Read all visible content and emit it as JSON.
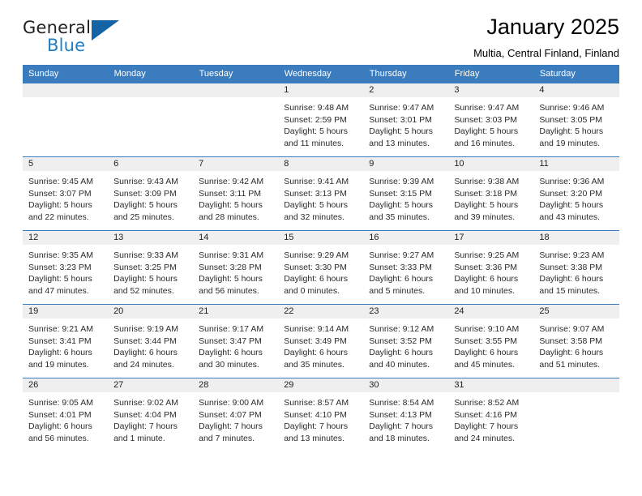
{
  "brand": {
    "name_part1": "General",
    "name_part2": "Blue",
    "triangle_color": "#1464a5",
    "blue_color": "#1f7fc4"
  },
  "header": {
    "title": "January 2025",
    "subtitle": "Multia, Central Finland, Finland"
  },
  "theme": {
    "header_bar_color": "#3a7cbe",
    "daynum_band_color": "#efefef",
    "cell_background": "#ffffff",
    "text_color": "#2b2b2b"
  },
  "weekdays": [
    "Sunday",
    "Monday",
    "Tuesday",
    "Wednesday",
    "Thursday",
    "Friday",
    "Saturday"
  ],
  "weeks": [
    [
      {
        "day": "",
        "empty": true,
        "sunrise": "",
        "sunset": "",
        "daylight_line1": "",
        "daylight_line2": ""
      },
      {
        "day": "",
        "empty": true,
        "sunrise": "",
        "sunset": "",
        "daylight_line1": "",
        "daylight_line2": ""
      },
      {
        "day": "",
        "empty": true,
        "sunrise": "",
        "sunset": "",
        "daylight_line1": "",
        "daylight_line2": ""
      },
      {
        "day": "1",
        "empty": false,
        "sunrise": "Sunrise: 9:48 AM",
        "sunset": "Sunset: 2:59 PM",
        "daylight_line1": "Daylight: 5 hours",
        "daylight_line2": "and 11 minutes."
      },
      {
        "day": "2",
        "empty": false,
        "sunrise": "Sunrise: 9:47 AM",
        "sunset": "Sunset: 3:01 PM",
        "daylight_line1": "Daylight: 5 hours",
        "daylight_line2": "and 13 minutes."
      },
      {
        "day": "3",
        "empty": false,
        "sunrise": "Sunrise: 9:47 AM",
        "sunset": "Sunset: 3:03 PM",
        "daylight_line1": "Daylight: 5 hours",
        "daylight_line2": "and 16 minutes."
      },
      {
        "day": "4",
        "empty": false,
        "sunrise": "Sunrise: 9:46 AM",
        "sunset": "Sunset: 3:05 PM",
        "daylight_line1": "Daylight: 5 hours",
        "daylight_line2": "and 19 minutes."
      }
    ],
    [
      {
        "day": "5",
        "empty": false,
        "sunrise": "Sunrise: 9:45 AM",
        "sunset": "Sunset: 3:07 PM",
        "daylight_line1": "Daylight: 5 hours",
        "daylight_line2": "and 22 minutes."
      },
      {
        "day": "6",
        "empty": false,
        "sunrise": "Sunrise: 9:43 AM",
        "sunset": "Sunset: 3:09 PM",
        "daylight_line1": "Daylight: 5 hours",
        "daylight_line2": "and 25 minutes."
      },
      {
        "day": "7",
        "empty": false,
        "sunrise": "Sunrise: 9:42 AM",
        "sunset": "Sunset: 3:11 PM",
        "daylight_line1": "Daylight: 5 hours",
        "daylight_line2": "and 28 minutes."
      },
      {
        "day": "8",
        "empty": false,
        "sunrise": "Sunrise: 9:41 AM",
        "sunset": "Sunset: 3:13 PM",
        "daylight_line1": "Daylight: 5 hours",
        "daylight_line2": "and 32 minutes."
      },
      {
        "day": "9",
        "empty": false,
        "sunrise": "Sunrise: 9:39 AM",
        "sunset": "Sunset: 3:15 PM",
        "daylight_line1": "Daylight: 5 hours",
        "daylight_line2": "and 35 minutes."
      },
      {
        "day": "10",
        "empty": false,
        "sunrise": "Sunrise: 9:38 AM",
        "sunset": "Sunset: 3:18 PM",
        "daylight_line1": "Daylight: 5 hours",
        "daylight_line2": "and 39 minutes."
      },
      {
        "day": "11",
        "empty": false,
        "sunrise": "Sunrise: 9:36 AM",
        "sunset": "Sunset: 3:20 PM",
        "daylight_line1": "Daylight: 5 hours",
        "daylight_line2": "and 43 minutes."
      }
    ],
    [
      {
        "day": "12",
        "empty": false,
        "sunrise": "Sunrise: 9:35 AM",
        "sunset": "Sunset: 3:23 PM",
        "daylight_line1": "Daylight: 5 hours",
        "daylight_line2": "and 47 minutes."
      },
      {
        "day": "13",
        "empty": false,
        "sunrise": "Sunrise: 9:33 AM",
        "sunset": "Sunset: 3:25 PM",
        "daylight_line1": "Daylight: 5 hours",
        "daylight_line2": "and 52 minutes."
      },
      {
        "day": "14",
        "empty": false,
        "sunrise": "Sunrise: 9:31 AM",
        "sunset": "Sunset: 3:28 PM",
        "daylight_line1": "Daylight: 5 hours",
        "daylight_line2": "and 56 minutes."
      },
      {
        "day": "15",
        "empty": false,
        "sunrise": "Sunrise: 9:29 AM",
        "sunset": "Sunset: 3:30 PM",
        "daylight_line1": "Daylight: 6 hours",
        "daylight_line2": "and 0 minutes."
      },
      {
        "day": "16",
        "empty": false,
        "sunrise": "Sunrise: 9:27 AM",
        "sunset": "Sunset: 3:33 PM",
        "daylight_line1": "Daylight: 6 hours",
        "daylight_line2": "and 5 minutes."
      },
      {
        "day": "17",
        "empty": false,
        "sunrise": "Sunrise: 9:25 AM",
        "sunset": "Sunset: 3:36 PM",
        "daylight_line1": "Daylight: 6 hours",
        "daylight_line2": "and 10 minutes."
      },
      {
        "day": "18",
        "empty": false,
        "sunrise": "Sunrise: 9:23 AM",
        "sunset": "Sunset: 3:38 PM",
        "daylight_line1": "Daylight: 6 hours",
        "daylight_line2": "and 15 minutes."
      }
    ],
    [
      {
        "day": "19",
        "empty": false,
        "sunrise": "Sunrise: 9:21 AM",
        "sunset": "Sunset: 3:41 PM",
        "daylight_line1": "Daylight: 6 hours",
        "daylight_line2": "and 19 minutes."
      },
      {
        "day": "20",
        "empty": false,
        "sunrise": "Sunrise: 9:19 AM",
        "sunset": "Sunset: 3:44 PM",
        "daylight_line1": "Daylight: 6 hours",
        "daylight_line2": "and 24 minutes."
      },
      {
        "day": "21",
        "empty": false,
        "sunrise": "Sunrise: 9:17 AM",
        "sunset": "Sunset: 3:47 PM",
        "daylight_line1": "Daylight: 6 hours",
        "daylight_line2": "and 30 minutes."
      },
      {
        "day": "22",
        "empty": false,
        "sunrise": "Sunrise: 9:14 AM",
        "sunset": "Sunset: 3:49 PM",
        "daylight_line1": "Daylight: 6 hours",
        "daylight_line2": "and 35 minutes."
      },
      {
        "day": "23",
        "empty": false,
        "sunrise": "Sunrise: 9:12 AM",
        "sunset": "Sunset: 3:52 PM",
        "daylight_line1": "Daylight: 6 hours",
        "daylight_line2": "and 40 minutes."
      },
      {
        "day": "24",
        "empty": false,
        "sunrise": "Sunrise: 9:10 AM",
        "sunset": "Sunset: 3:55 PM",
        "daylight_line1": "Daylight: 6 hours",
        "daylight_line2": "and 45 minutes."
      },
      {
        "day": "25",
        "empty": false,
        "sunrise": "Sunrise: 9:07 AM",
        "sunset": "Sunset: 3:58 PM",
        "daylight_line1": "Daylight: 6 hours",
        "daylight_line2": "and 51 minutes."
      }
    ],
    [
      {
        "day": "26",
        "empty": false,
        "sunrise": "Sunrise: 9:05 AM",
        "sunset": "Sunset: 4:01 PM",
        "daylight_line1": "Daylight: 6 hours",
        "daylight_line2": "and 56 minutes."
      },
      {
        "day": "27",
        "empty": false,
        "sunrise": "Sunrise: 9:02 AM",
        "sunset": "Sunset: 4:04 PM",
        "daylight_line1": "Daylight: 7 hours",
        "daylight_line2": "and 1 minute."
      },
      {
        "day": "28",
        "empty": false,
        "sunrise": "Sunrise: 9:00 AM",
        "sunset": "Sunset: 4:07 PM",
        "daylight_line1": "Daylight: 7 hours",
        "daylight_line2": "and 7 minutes."
      },
      {
        "day": "29",
        "empty": false,
        "sunrise": "Sunrise: 8:57 AM",
        "sunset": "Sunset: 4:10 PM",
        "daylight_line1": "Daylight: 7 hours",
        "daylight_line2": "and 13 minutes."
      },
      {
        "day": "30",
        "empty": false,
        "sunrise": "Sunrise: 8:54 AM",
        "sunset": "Sunset: 4:13 PM",
        "daylight_line1": "Daylight: 7 hours",
        "daylight_line2": "and 18 minutes."
      },
      {
        "day": "31",
        "empty": false,
        "sunrise": "Sunrise: 8:52 AM",
        "sunset": "Sunset: 4:16 PM",
        "daylight_line1": "Daylight: 7 hours",
        "daylight_line2": "and 24 minutes."
      },
      {
        "day": "",
        "empty": true,
        "sunrise": "",
        "sunset": "",
        "daylight_line1": "",
        "daylight_line2": ""
      }
    ]
  ]
}
